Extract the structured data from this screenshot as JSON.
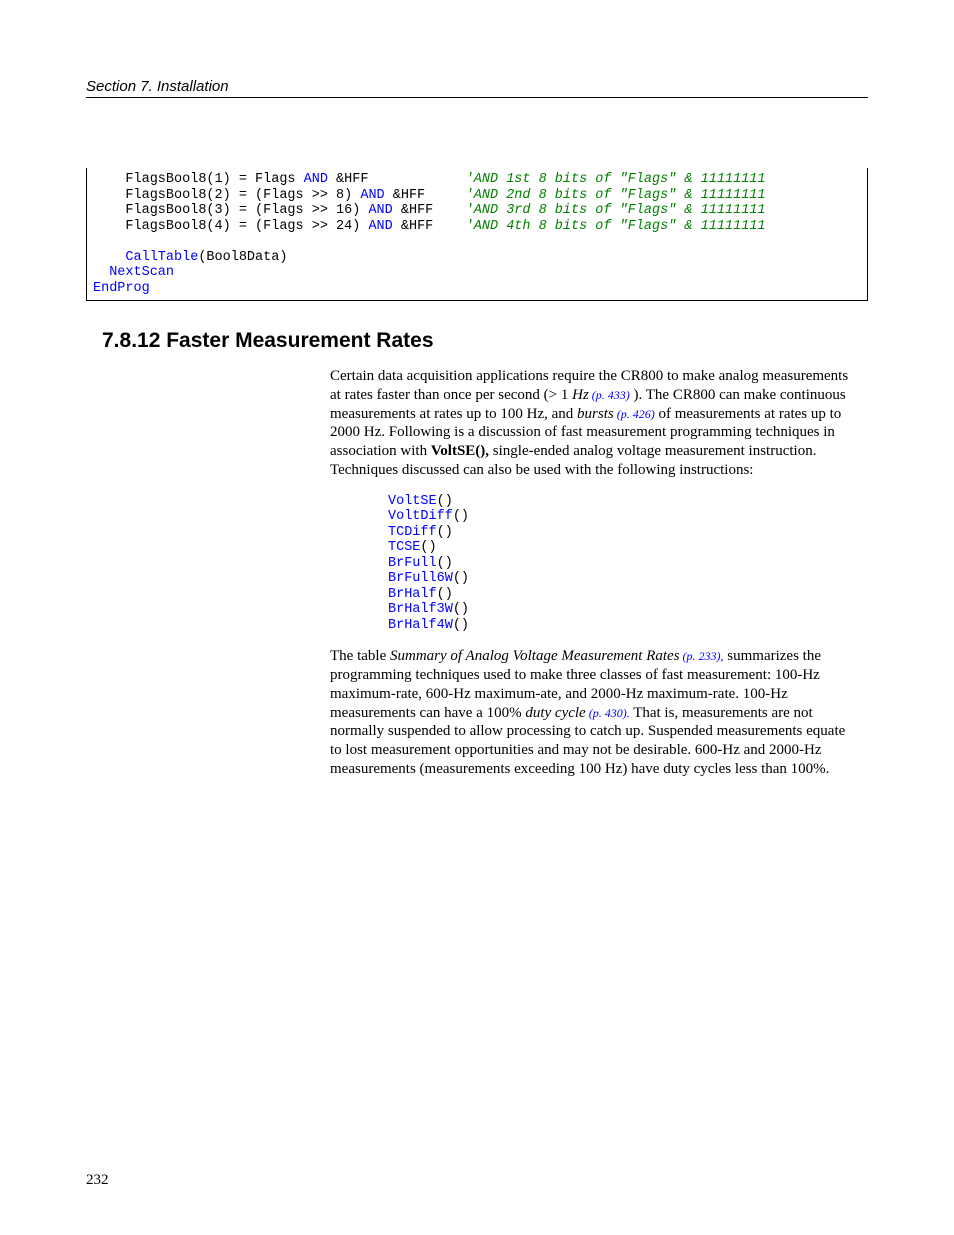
{
  "header": "Section 7.  Installation",
  "page_number": "232",
  "code": {
    "l1a": "    FlagsBool8(1) = Flags ",
    "l1b": "AND",
    "l1c": " &HFF            ",
    "l1d": "'AND 1st 8 bits of \"Flags\" & 11111111",
    "l2a": "    FlagsBool8(2) = (Flags >> 8) ",
    "l2b": "AND",
    "l2c": " &HFF     ",
    "l2d": "'AND 2nd 8 bits of \"Flags\" & 11111111",
    "l3a": "    FlagsBool8(3) = (Flags >> 16) ",
    "l3b": "AND",
    "l3c": " &HFF    ",
    "l3d": "'AND 3rd 8 bits of \"Flags\" & 11111111",
    "l4a": "    FlagsBool8(4) = (Flags >> 24) ",
    "l4b": "AND",
    "l4c": " &HFF    ",
    "l4d": "'AND 4th 8 bits of \"Flags\" & 11111111",
    "blank": " ",
    "l5a": "    ",
    "l5b": "CallTable",
    "l5c": "(Bool8Data)",
    "l6": "  NextScan",
    "l7": "EndProg"
  },
  "heading": "7.8.12 Faster Measurement Rates",
  "para1": {
    "t1": "Certain data acquisition applications require the CR800 to make analog measurements at rates faster than once per second (> 1 ",
    "hz": "Hz",
    "r1": " (p. 433)",
    "t2": " ).  The CR800 can make continuous measurements at rates up to 100 Hz, and ",
    "bursts": "bursts",
    "r2": " (p. 426)",
    "t3": " of measurements at rates up to 2000 Hz.  Following is a discussion of fast measurement programming techniques in association with ",
    "bold": "VoltSE(),",
    "t4": " single-ended analog voltage measurement instruction.  Techniques discussed can also be used with the following instructions:"
  },
  "instructions": [
    {
      "name": "VoltSE",
      "suffix": "()"
    },
    {
      "name": "VoltDiff",
      "suffix": "()"
    },
    {
      "name": "TCDiff",
      "suffix": "()"
    },
    {
      "name": "TCSE",
      "suffix": "()"
    },
    {
      "name": "BrFull",
      "suffix": "()"
    },
    {
      "name": "BrFull6W",
      "suffix": "()"
    },
    {
      "name": "BrHalf",
      "suffix": "()"
    },
    {
      "name": "BrHalf3W",
      "suffix": "()"
    },
    {
      "name": "BrHalf4W",
      "suffix": "()"
    }
  ],
  "para2": {
    "t1": "The table ",
    "ital1": "Summary of Analog Voltage Measurement Rates",
    "r1": " (p. 233),",
    "t2": " summarizes the programming techniques used to make three classes of fast measurement: 100-Hz maximum-rate, 600-Hz maximum-ate, and 2000-Hz maximum-rate.  100-Hz measurements can have a 100% ",
    "ital2": "duty cycle",
    "r2": " (p. 430).",
    "t3": "  That is, measurements are not normally suspended to allow processing to catch up.  Suspended measurements equate to lost measurement opportunities and may not be desirable.  600-Hz and 2000-Hz measurements (measurements exceeding 100 Hz) have duty cycles less than 100%."
  }
}
